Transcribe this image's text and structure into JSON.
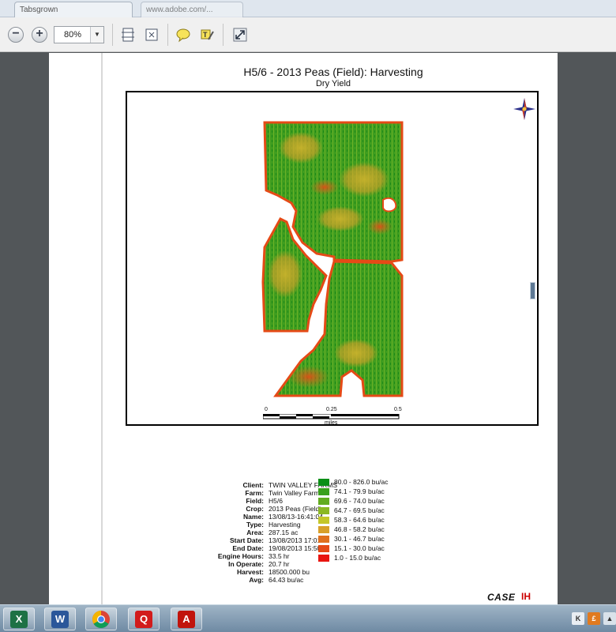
{
  "browser": {
    "tabs": [
      {
        "label": "Tabsgrown"
      },
      {
        "label": "www.adobe.com/..."
      }
    ]
  },
  "toolbar": {
    "zoom_value": "80%"
  },
  "report": {
    "title": "H5/6 - 2013 Peas (Field): Harvesting",
    "subtitle": "Dry Yield",
    "scale": {
      "labels": [
        "0",
        "0.25",
        "0.5"
      ],
      "unit": "miles"
    },
    "info": [
      {
        "label": "Client:",
        "value": "TWIN VALLEY FARMS"
      },
      {
        "label": "Farm:",
        "value": "Twin Valley Farms"
      },
      {
        "label": "Field:",
        "value": "H5/6"
      },
      {
        "label": "Crop:",
        "value": "2013 Peas (Field)"
      },
      {
        "label": "Name:",
        "value": "13/08/13-16:41:04"
      },
      {
        "label": "Type:",
        "value": "Harvesting"
      },
      {
        "label": "Area:",
        "value": "287.15 ac"
      },
      {
        "label": "Start Date:",
        "value": "13/08/2013 17:01"
      },
      {
        "label": "End Date:",
        "value": "19/08/2013 15:50"
      },
      {
        "label": "Engine Hours:",
        "value": "33.5 hr"
      },
      {
        "label": "In Operate:",
        "value": "20.7 hr"
      },
      {
        "label": "Harvest:",
        "value": "18500.000 bu"
      },
      {
        "label": "Avg:",
        "value": "64.43 bu/ac"
      }
    ],
    "legend": [
      {
        "label": "80.0 - 826.0 bu/ac",
        "color": "#0a8f16"
      },
      {
        "label": "74.1 - 79.9 bu/ac",
        "color": "#3aa01c"
      },
      {
        "label": "69.6 - 74.0 bu/ac",
        "color": "#62ac20"
      },
      {
        "label": "64.7 - 69.5 bu/ac",
        "color": "#8bb824"
      },
      {
        "label": "58.3 - 64.6 bu/ac",
        "color": "#c4c72a"
      },
      {
        "label": "46.8 - 58.2 bu/ac",
        "color": "#d8a02a"
      },
      {
        "label": "30.1 - 46.7 bu/ac",
        "color": "#e0701e"
      },
      {
        "label": "15.1 - 30.0 bu/ac",
        "color": "#e54a16"
      },
      {
        "label": "1.0 - 15.0 bu/ac",
        "color": "#e81510"
      }
    ],
    "brand": {
      "name": "CASE",
      "mark": "IH"
    }
  },
  "taskbar": {
    "apps": [
      {
        "name": "excel",
        "glyph": "X",
        "color": "#1e7145"
      },
      {
        "name": "word",
        "glyph": "W",
        "color": "#2b579a"
      },
      {
        "name": "chrome",
        "glyph": "",
        "color": "#ffffff"
      },
      {
        "name": "quickbooks",
        "glyph": "Q",
        "color": "#d21b1b"
      },
      {
        "name": "acrobat",
        "glyph": "A",
        "color": "#c1140c"
      }
    ]
  }
}
